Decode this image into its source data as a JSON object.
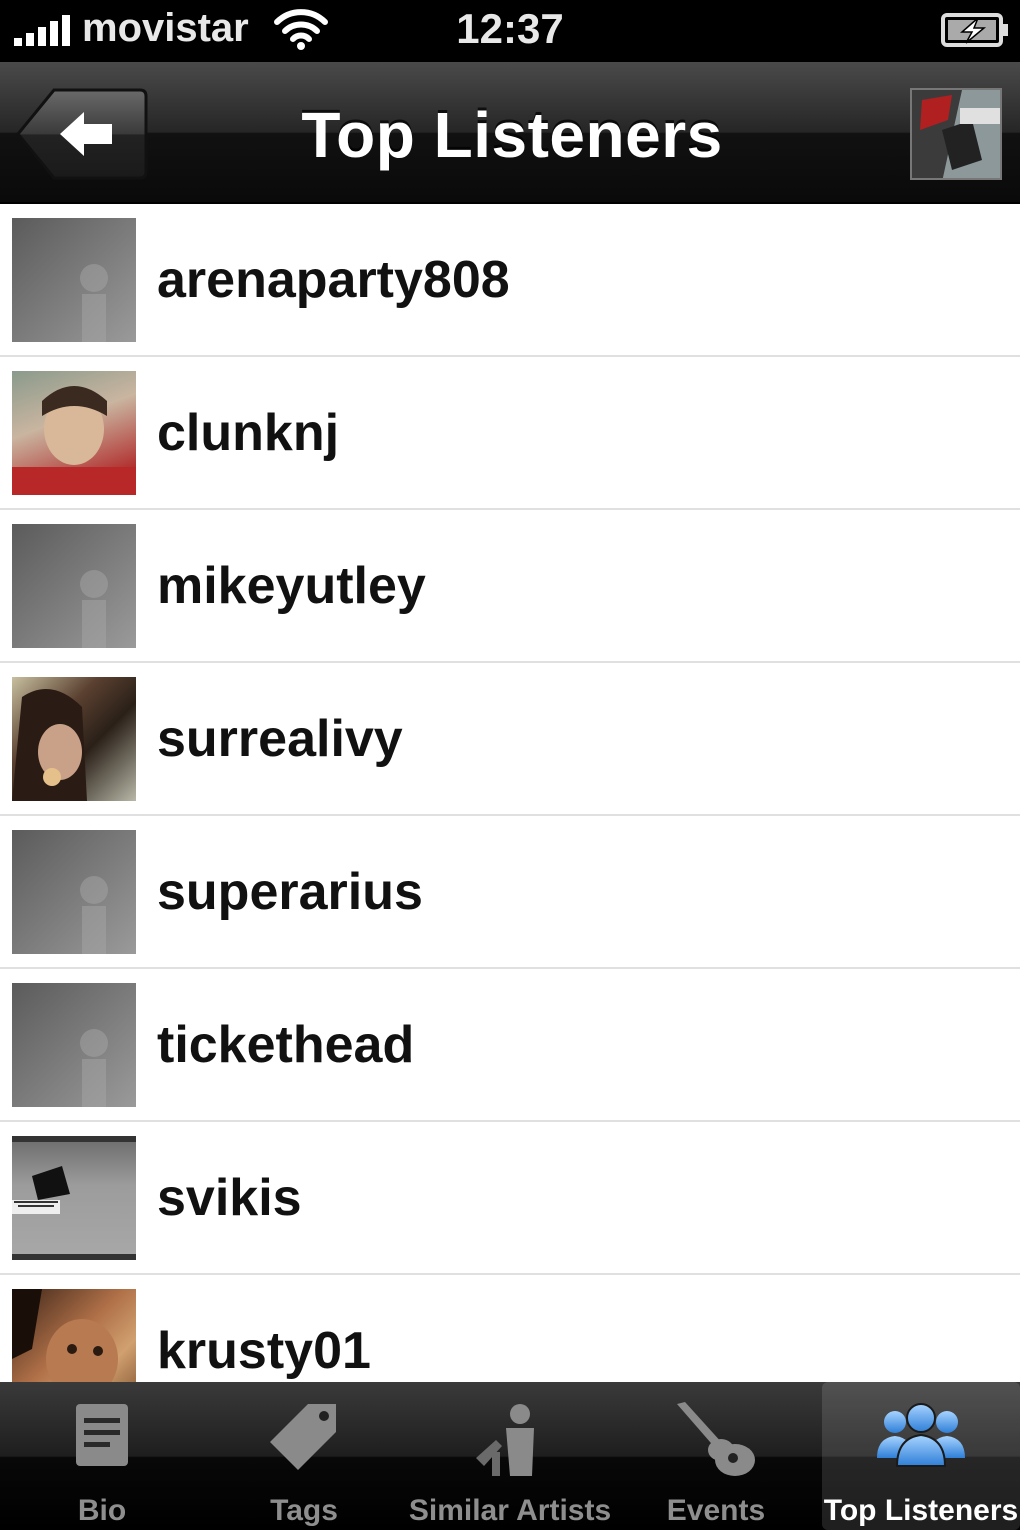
{
  "status_bar": {
    "carrier": "movistar",
    "time": "12:37"
  },
  "nav_bar": {
    "title": "Top Listeners",
    "back_icon": "left-arrow-icon"
  },
  "listeners": [
    {
      "username": "arenaparty808",
      "avatar": "default"
    },
    {
      "username": "clunknj",
      "avatar": "photo"
    },
    {
      "username": "mikeyutley",
      "avatar": "default"
    },
    {
      "username": "surrealivy",
      "avatar": "photo"
    },
    {
      "username": "superarius",
      "avatar": "default"
    },
    {
      "username": "tickethead",
      "avatar": "default"
    },
    {
      "username": "svikis",
      "avatar": "photo"
    },
    {
      "username": "krusty01",
      "avatar": "photo"
    }
  ],
  "tab_bar": {
    "selected": "Top Listeners",
    "tabs": [
      {
        "label": "Bio",
        "icon": "document-icon"
      },
      {
        "label": "Tags",
        "icon": "tag-icon"
      },
      {
        "label": "Similar Artists",
        "icon": "people-silhouette-icon"
      },
      {
        "label": "Events",
        "icon": "guitar-icon"
      },
      {
        "label": "Top Listeners",
        "icon": "users-icon"
      }
    ]
  },
  "colors": {
    "accent": "#3a8ee6",
    "tab_inactive": "#8e8e8e",
    "list_bg": "#ffffff",
    "divider": "#e0e0e0"
  }
}
